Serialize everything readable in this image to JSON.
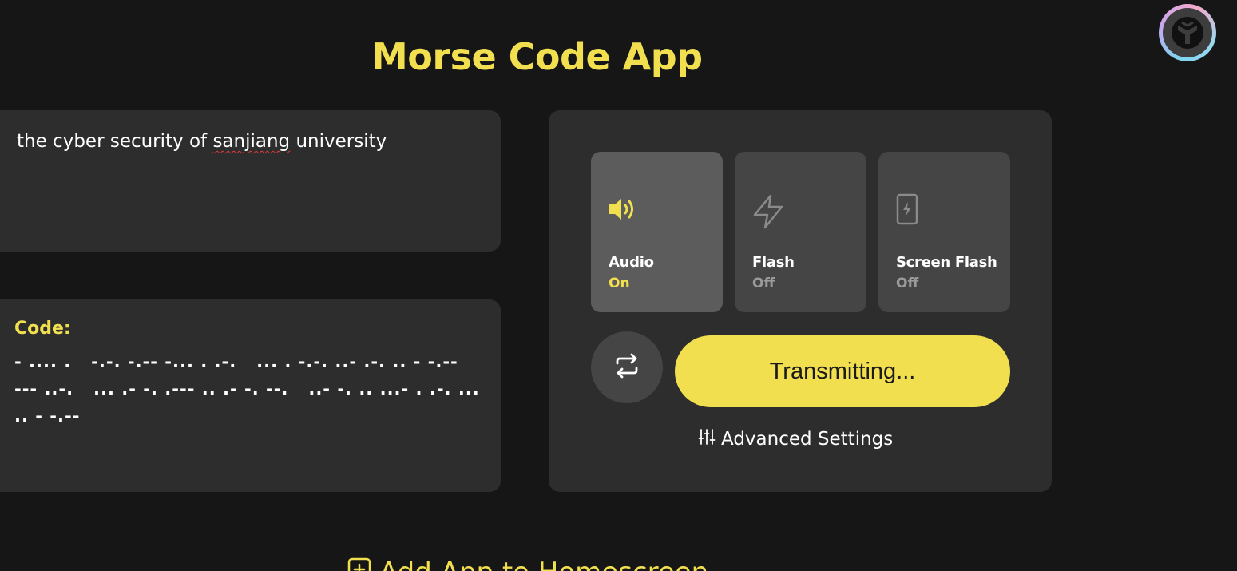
{
  "app": {
    "title": "Morse Code App"
  },
  "input": {
    "text_before": "the cyber security of ",
    "text_misspelled": "sanjiang",
    "text_after": " university"
  },
  "output": {
    "label": "Code:",
    "code": "- .... .   -.-. -.-- -... . .-.   ... . -.-. ..- .-. .. - -.--   --- ..-.   ... .- -. .--- .. .- -. --.   ..- -. .. ...- . .-. ... .. - -.--"
  },
  "modes": [
    {
      "label": "Audio",
      "status": "On",
      "icon": "speaker-icon",
      "active": true
    },
    {
      "label": "Flash",
      "status": "Off",
      "icon": "lightning-icon",
      "active": false
    },
    {
      "label": "Screen Flash",
      "status": "Off",
      "icon": "phone-flash-icon",
      "active": false
    }
  ],
  "controls": {
    "transmit_label": "Transmitting...",
    "repeat_icon": "repeat-icon",
    "advanced_label": "Advanced Settings",
    "advanced_icon": "sliders-icon"
  },
  "footer": {
    "add_app_label": "Add App to Homescreen",
    "add_app_icon": "plus-square-icon"
  },
  "colors": {
    "accent": "#f1df4f",
    "background": "#161616",
    "card": "#2d2d2d",
    "tile": "#454545",
    "tile_active": "#5c5c5c"
  }
}
